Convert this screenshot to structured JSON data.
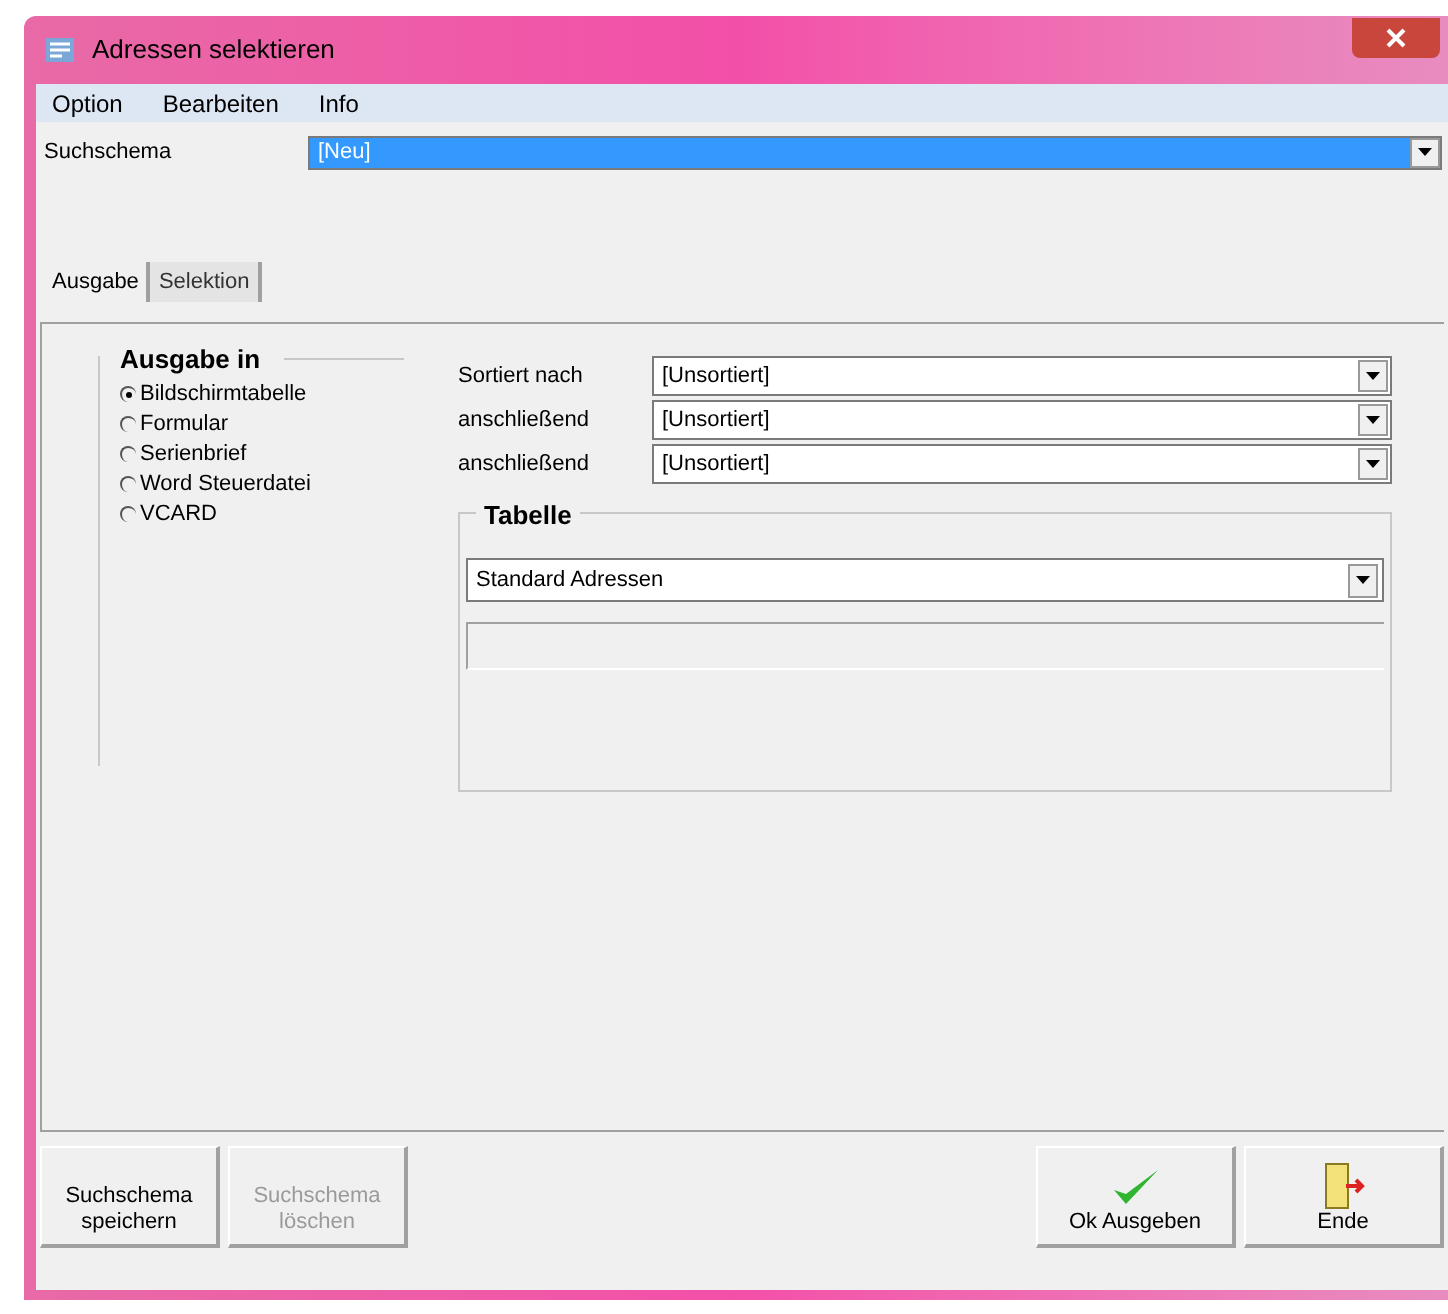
{
  "window": {
    "title": "Adressen selektieren"
  },
  "menu": [
    "Option",
    "Bearbeiten",
    "Info"
  ],
  "search_scheme": {
    "label": "Suchschema",
    "value": "[Neu]"
  },
  "tabs": [
    {
      "label": "Ausgabe",
      "selected": true
    },
    {
      "label": "Selektion",
      "selected": false
    }
  ],
  "output_group": {
    "title": "Ausgabe in",
    "options": [
      {
        "label": "Bildschirmtabelle",
        "selected": true
      },
      {
        "label": "Formular",
        "selected": false
      },
      {
        "label": "Serienbrief",
        "selected": false
      },
      {
        "label": "Word Steuerdatei",
        "selected": false
      },
      {
        "label": "VCARD",
        "selected": false
      }
    ]
  },
  "sort_fields": [
    {
      "label": "Sortiert nach",
      "value": "[Unsortiert]"
    },
    {
      "label": "anschließend",
      "value": "[Unsortiert]"
    },
    {
      "label": "anschließend",
      "value": "[Unsortiert]"
    }
  ],
  "table_group": {
    "title": "Tabelle",
    "value": "Standard Adressen"
  },
  "buttons": [
    {
      "kind": "text",
      "label": "Suchschema speichern",
      "disabled": false
    },
    {
      "kind": "text",
      "label": "Suchschema löschen",
      "disabled": true
    },
    {
      "kind": "ok",
      "label": "Ok Ausgeben",
      "disabled": false
    },
    {
      "kind": "exit",
      "label": "Ende",
      "disabled": false
    }
  ]
}
